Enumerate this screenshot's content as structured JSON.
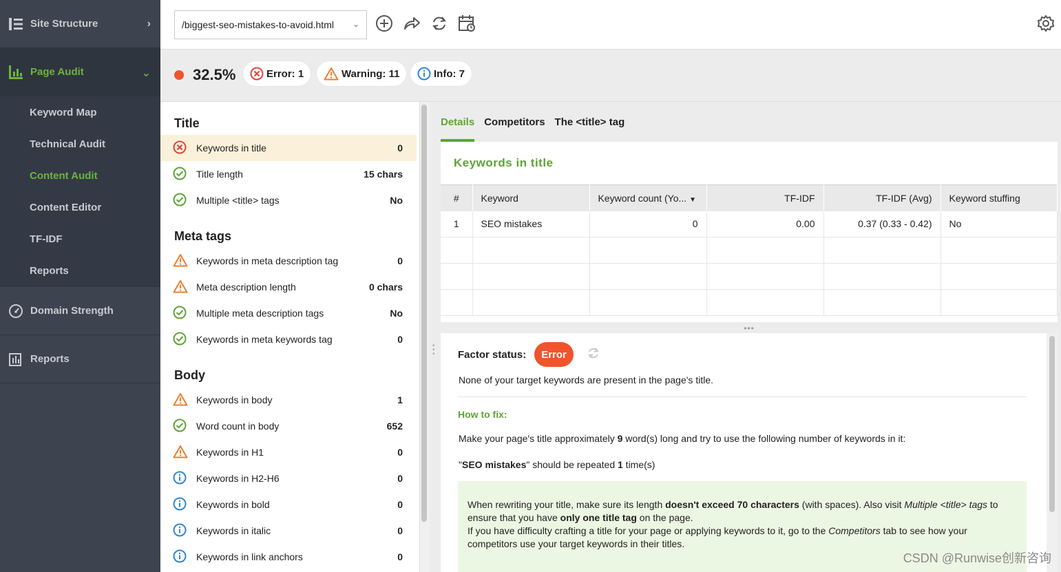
{
  "sidebar": {
    "site_structure": "Site Structure",
    "page_audit": "Page Audit",
    "sub_items": [
      "Keyword Map",
      "Technical Audit",
      "Content Audit",
      "Content Editor",
      "TF-IDF",
      "Reports"
    ],
    "domain_strength": "Domain Strength",
    "reports": "Reports"
  },
  "topbar": {
    "url": "/biggest-seo-mistakes-to-avoid.html"
  },
  "score": {
    "value": "32.5%",
    "error": "Error: 1",
    "warning": "Warning: 11",
    "info": "Info: 7"
  },
  "factors": {
    "title_group": "Title",
    "title_rows": [
      {
        "label": "Keywords in title",
        "value": "0"
      },
      {
        "label": "Title length",
        "value": "15 chars"
      },
      {
        "label": "Multiple <title> tags",
        "value": "No"
      }
    ],
    "meta_group": "Meta tags",
    "meta_rows": [
      {
        "label": "Keywords in meta description tag",
        "value": "0"
      },
      {
        "label": "Meta description length",
        "value": "0 chars"
      },
      {
        "label": "Multiple meta description tags",
        "value": "No"
      },
      {
        "label": "Keywords in meta keywords tag",
        "value": "0"
      }
    ],
    "body_group": "Body",
    "body_rows": [
      {
        "label": "Keywords in body",
        "value": "1"
      },
      {
        "label": "Word count in body",
        "value": "652"
      },
      {
        "label": "Keywords in H1",
        "value": "0"
      },
      {
        "label": "Keywords in H2-H6",
        "value": "0"
      },
      {
        "label": "Keywords in bold",
        "value": "0"
      },
      {
        "label": "Keywords in italic",
        "value": "0"
      },
      {
        "label": "Keywords in link anchors",
        "value": "0"
      }
    ]
  },
  "tabs": [
    "Details",
    "Competitors",
    "The <title> tag"
  ],
  "keywords_card": {
    "title": "Keywords in title",
    "headers": [
      "#",
      "Keyword",
      "Keyword count (Yo...",
      "TF-IDF",
      "TF-IDF (Avg)",
      "Keyword stuffing"
    ],
    "row": [
      "1",
      "SEO mistakes",
      "0",
      "0.00",
      "0.37 (0.33 - 0.42)",
      "No"
    ]
  },
  "detail": {
    "factor_status_label": "Factor status:",
    "status": "Error",
    "description": "None of your target keywords are present in the page's title.",
    "how_to_fix": "How to fix:",
    "fix_pre": "Make your page's title approximately ",
    "fix_num": "9",
    "fix_post": " word(s) long and try to use the following number of keywords in it:",
    "kw_quote_open": "\"",
    "kw_name": "SEO mistakes",
    "kw_quote_close": "\" should be repeated ",
    "kw_times": "1",
    "kw_suffix": " time(s)",
    "tip_1a": "When rewriting your title, make sure its length ",
    "tip_1b": "doesn't exceed 70 characters",
    "tip_1c": " (with spaces). Also visit ",
    "tip_1d": "Multiple <title> tags",
    "tip_1e": " to ensure that you have ",
    "tip_1f": "only one title tag",
    "tip_1g": " on the page.",
    "tip_2a": "If you have difficulty crafting a title for your page or applying keywords to it, go to the ",
    "tip_2b": "Competitors",
    "tip_2c": " tab to see how your competitors use your target keywords in their titles."
  },
  "watermark": "CSDN @Runwise创新咨询",
  "colors": {
    "accent": "#5fa336",
    "error": "#f0542d",
    "warning": "#f07c2d",
    "info": "#2d86d6",
    "sidebar": "#3d4450"
  }
}
